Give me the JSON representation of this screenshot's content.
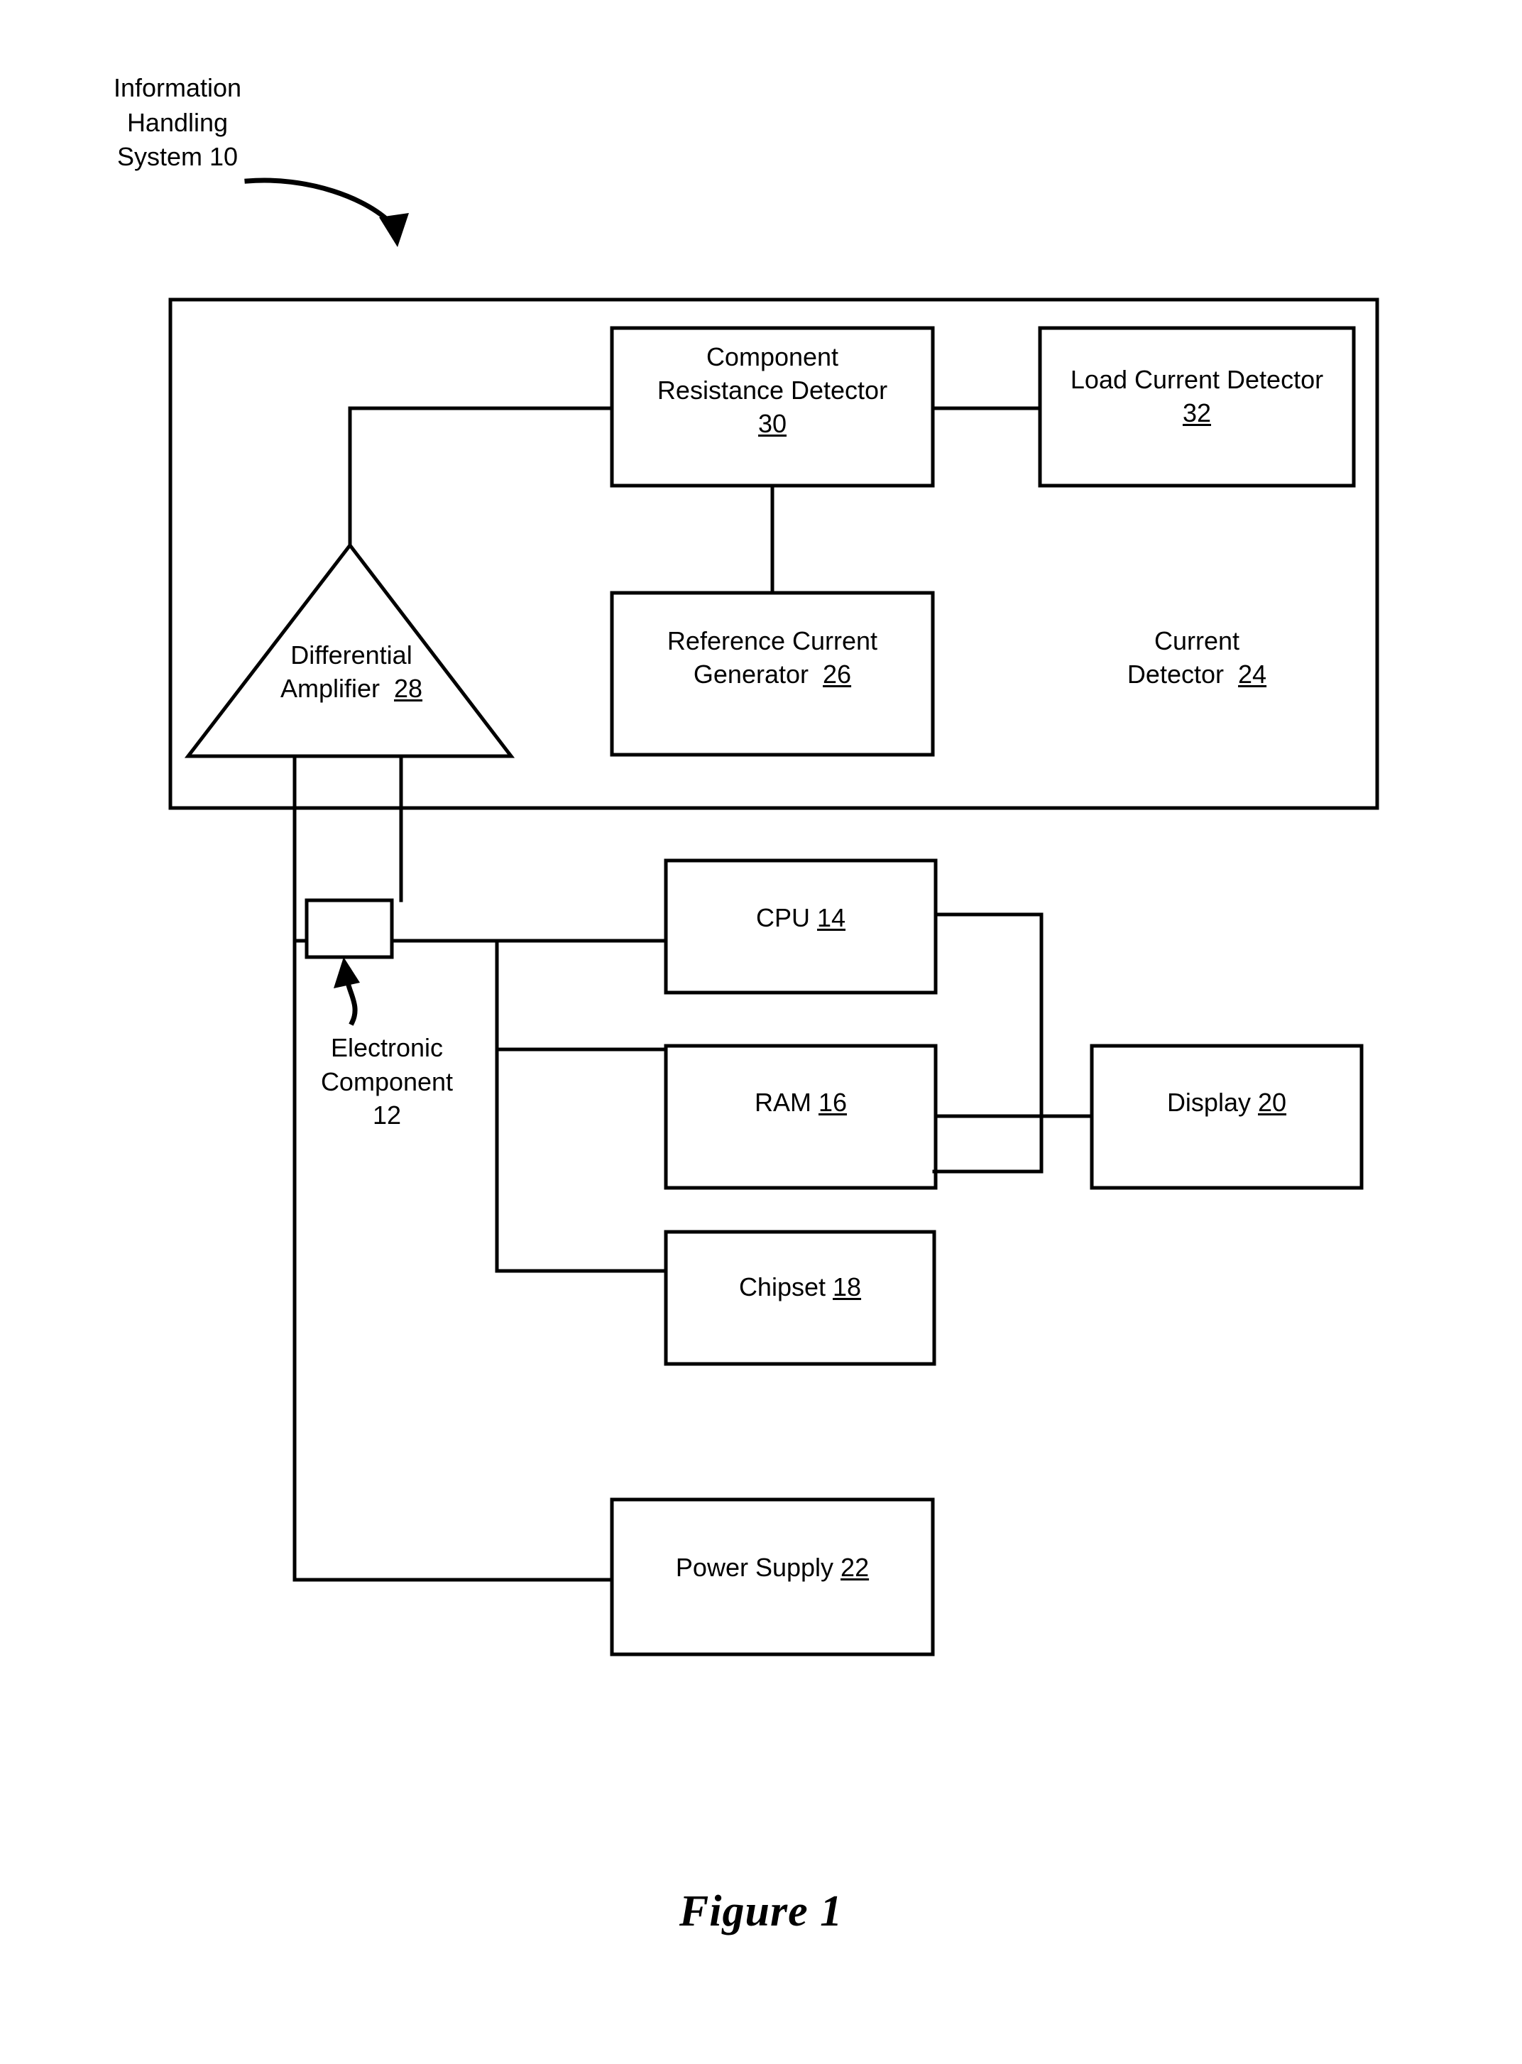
{
  "figure": {
    "caption": "Figure 1",
    "system_label": "Information Handling System 10"
  },
  "blocks": {
    "component_resistance_detector": {
      "line1": "Component",
      "line2": "Resistance Detector",
      "ref": "30"
    },
    "load_current_detector": {
      "line1": "Load Current Detector",
      "ref": "32"
    },
    "reference_current_generator": {
      "line1": "Reference Current",
      "line2": "Generator",
      "ref": "26"
    },
    "current_detector": {
      "line1": "Current",
      "line2": "Detector",
      "ref": "24"
    },
    "differential_amplifier": {
      "line1": "Differential",
      "line2": "Amplifier",
      "ref": "28"
    },
    "electronic_component": {
      "line1": "Electronic",
      "line2": "Component",
      "ref": "12"
    },
    "cpu": {
      "line1": "CPU",
      "ref": "14"
    },
    "ram": {
      "line1": "RAM",
      "ref": "16"
    },
    "chipset": {
      "line1": "Chipset",
      "ref": "18"
    },
    "display": {
      "line1": "Display",
      "ref": "20"
    },
    "power_supply": {
      "line1": "Power Supply",
      "ref": "22"
    }
  },
  "style": {
    "line_color": "#000000",
    "background": "#ffffff"
  }
}
